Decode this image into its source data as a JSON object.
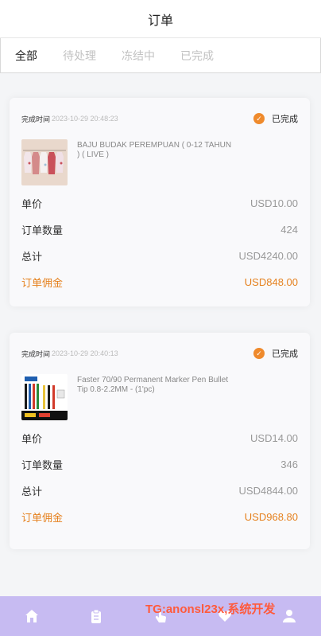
{
  "header": {
    "title": "订单"
  },
  "tabs": [
    {
      "label": "全部",
      "active": true
    },
    {
      "label": "待处理",
      "active": false
    },
    {
      "label": "冻结中",
      "active": false
    },
    {
      "label": "已完成",
      "active": false
    }
  ],
  "orders": [
    {
      "time_label": "完成时间",
      "time_value": "2023-10-29 20:48:23",
      "status": "已完成",
      "product_name": "BAJU BUDAK PEREMPUAN ( 0-12 TAHUN ) ( LIVE )",
      "unit_price_label": "单价",
      "unit_price": "USD10.00",
      "quantity_label": "订单数量",
      "quantity": "424",
      "total_label": "总计",
      "total": "USD4240.00",
      "commission_label": "订单佣金",
      "commission": "USD848.00"
    },
    {
      "time_label": "完成时间",
      "time_value": "2023-10-29 20:40:13",
      "status": "已完成",
      "product_name": "Faster 70/90 Permanent Marker Pen Bullet Tip 0.8-2.2MM - (1'pc)",
      "unit_price_label": "单价",
      "unit_price": "USD14.00",
      "quantity_label": "订单数量",
      "quantity": "346",
      "total_label": "总计",
      "total": "USD4844.00",
      "commission_label": "订单佣金",
      "commission": "USD968.80"
    }
  ],
  "bottom_nav": [
    {
      "icon": "home-icon"
    },
    {
      "icon": "clipboard-icon"
    },
    {
      "icon": "tap-hand-icon"
    },
    {
      "icon": "heart-icon"
    },
    {
      "icon": "user-icon"
    }
  ],
  "watermark": "TG:anonsl23x,系统开发",
  "colors": {
    "accent": "#e5811e",
    "status_icon": "#ef8a2c",
    "nav_bg": "#c7bbf2",
    "watermark": "#ff5a3c"
  }
}
